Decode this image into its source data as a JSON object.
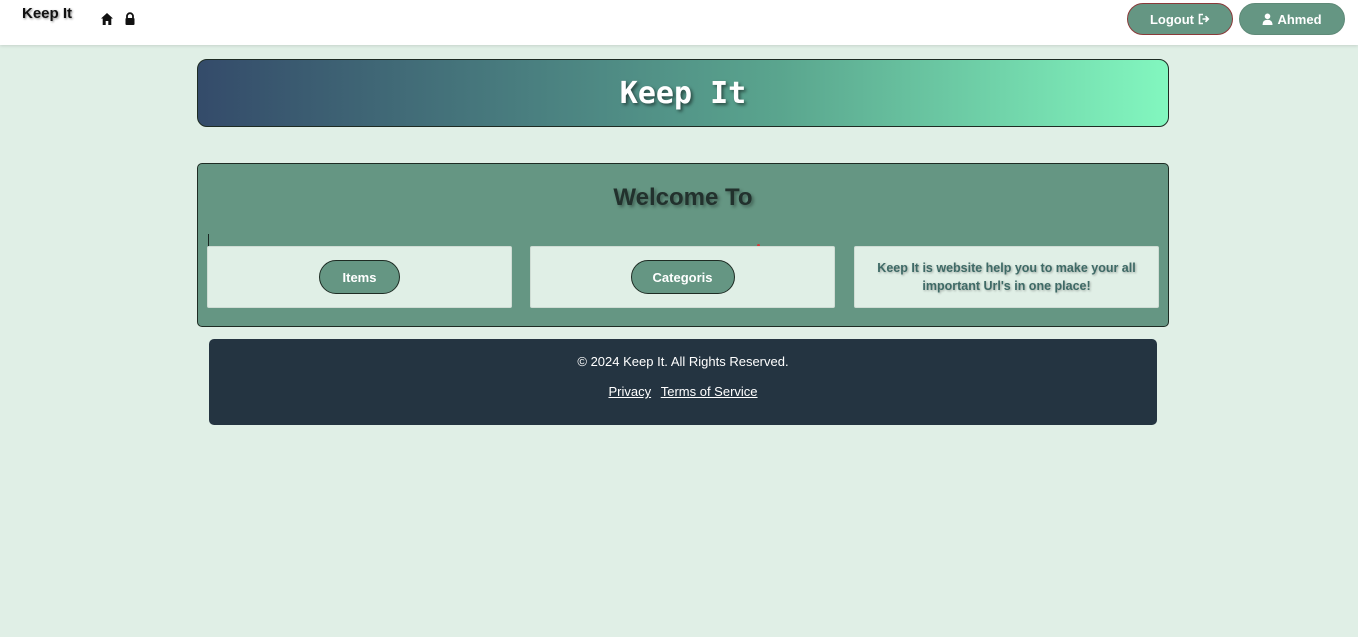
{
  "navbar": {
    "brand": "Keep It",
    "icons": [
      "home-icon",
      "lock-icon"
    ],
    "logout_label": "Logout",
    "user_label": "Ahmed"
  },
  "hero": {
    "title": "Keep It"
  },
  "welcome": {
    "title": "Welcome To",
    "cards": [
      {
        "button_label": "Items"
      },
      {
        "button_label": "Categoris"
      },
      {
        "text": "Keep It is website help you to make your all important Url's in one place!"
      }
    ]
  },
  "footer": {
    "copyright": "© 2024 Keep It. All Rights Reserved.",
    "links": [
      "Privacy",
      "Terms of Service"
    ]
  },
  "colors": {
    "page_background": "#e0efe6",
    "accent_green": "#659683",
    "footer_background": "#243441",
    "hero_gradient_start": "#344b6a",
    "hero_gradient_end": "#82f7bf"
  }
}
